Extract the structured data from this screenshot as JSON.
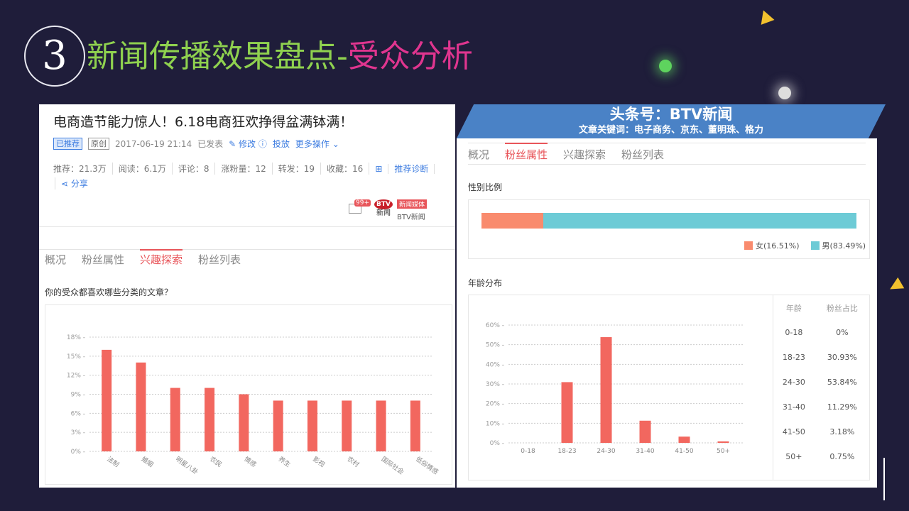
{
  "header": {
    "number": "3",
    "title_green": "新闻传播效果盘点-",
    "title_pink": "受众分析"
  },
  "colors": {
    "bg": "#1f1d3a",
    "green": "#8fd14f",
    "pink": "#e0358f",
    "bar_red": "#f2675f",
    "female": "#f98b6e",
    "male": "#6dcbd6",
    "banner": "#4a82c6"
  },
  "left": {
    "article_title": "电商造节能力惊人！6.18电商狂欢挣得盆满钵满！",
    "tag1": "已推荐",
    "tag2": "原创",
    "datetime": "2017-06-19 21:14",
    "status": "已发表",
    "edit": "修改",
    "post": "投放",
    "more": "更多操作",
    "stats": [
      "推荐：21.3万",
      "阅读：6.1万",
      "评论：8",
      "涨粉量：12",
      "转发：19",
      "收藏：16"
    ],
    "diagnose": "推荐诊断",
    "share": "分享",
    "badge": "99+",
    "logo_text": "BTV",
    "logo_sub": "新闻",
    "media_tag": "新闻媒体",
    "media_name": "BTV新闻",
    "tabs": [
      "概况",
      "粉丝属性",
      "兴趣探索",
      "粉丝列表"
    ],
    "question": "你的受众都喜欢哪些分类的文章？"
  },
  "right": {
    "banner_title": "头条号：BTV新闻",
    "banner_sub": "文章关键词：电子商务、京东、董明珠、格力",
    "tabs": [
      "概况",
      "粉丝属性",
      "兴趣探索",
      "粉丝列表"
    ],
    "gender_title": "性别比例",
    "legend_female": "女(16.51%)",
    "legend_male": "男(83.49%)",
    "age_title": "年龄分布",
    "table_headers": [
      "年龄",
      "粉丝占比"
    ],
    "table_rows": [
      [
        "0-18",
        "0%"
      ],
      [
        "18-23",
        "30.93%"
      ],
      [
        "24-30",
        "53.84%"
      ],
      [
        "31-40",
        "11.29%"
      ],
      [
        "41-50",
        "3.18%"
      ],
      [
        "50+",
        "0.75%"
      ]
    ]
  },
  "chart_data": [
    {
      "type": "bar",
      "categories": [
        "法制",
        "婚姻",
        "明星八卦",
        "农民",
        "情感",
        "养生",
        "影视",
        "农村",
        "国际社会",
        "低俗情感"
      ],
      "values": [
        16,
        14,
        10,
        10,
        9,
        8,
        8,
        8,
        8,
        8
      ],
      "ylim": [
        0,
        18
      ],
      "yticks": [
        "0%",
        "3%",
        "6%",
        "9%",
        "12%",
        "15%",
        "18%"
      ],
      "grid": true
    },
    {
      "type": "bar",
      "categories": [
        "0-18",
        "18-23",
        "24-30",
        "31-40",
        "41-50",
        "50+"
      ],
      "values": [
        0,
        30.93,
        53.84,
        11.29,
        3.18,
        0.75
      ],
      "ylim": [
        0,
        60
      ],
      "yticks": [
        "0%",
        "10%",
        "20%",
        "30%",
        "40%",
        "50%",
        "60%"
      ],
      "grid": true
    },
    {
      "type": "bar",
      "categories": [
        "女",
        "男"
      ],
      "values": [
        16.51,
        83.49
      ]
    }
  ]
}
